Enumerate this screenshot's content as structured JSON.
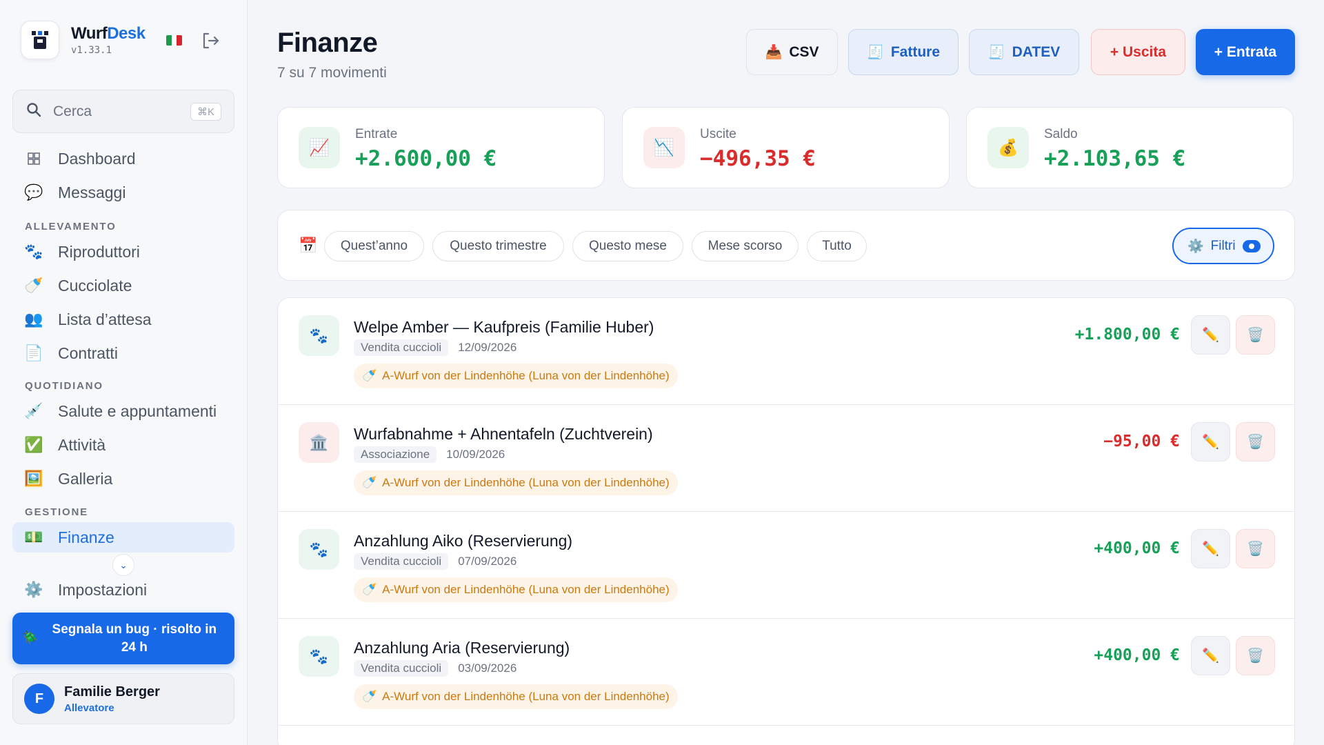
{
  "app": {
    "name_part1": "Wurf",
    "name_part2": "Desk",
    "version": "v1.33.1"
  },
  "search": {
    "label": "Cerca",
    "shortcut": "⌘K"
  },
  "nav": {
    "dashboard": "Dashboard",
    "messages": "Messaggi",
    "section_breeding": "ALLEVAMENTO",
    "breeders": "Riproduttori",
    "litters": "Cucciolate",
    "waitlist": "Lista d’attesa",
    "contracts": "Contratti",
    "section_daily": "QUOTIDIANO",
    "health": "Salute e appuntamenti",
    "tasks": "Attività",
    "gallery": "Galleria",
    "section_management": "GESTIONE",
    "finance": "Finanze",
    "settings": "Impostazioni"
  },
  "bug_button": "Segnala un bug · risolto in 24 h",
  "user": {
    "initial": "F",
    "name": "Familie Berger",
    "role": "Allevatore"
  },
  "page": {
    "title": "Finanze",
    "subtitle": "7 su 7 movimenti"
  },
  "toolbar": {
    "csv": "CSV",
    "invoices": "Fatture",
    "datev": "DATEV",
    "expense": "+ Uscita",
    "income": "+ Entrata"
  },
  "stats": {
    "income_label": "Entrate",
    "income_value": "+2.600,00 €",
    "expense_label": "Uscite",
    "expense_value": "−496,35 €",
    "balance_label": "Saldo",
    "balance_value": "+2.103,65 €"
  },
  "filters": {
    "chips": [
      "Quest’anno",
      "Questo trimestre",
      "Questo mese",
      "Mese scorso",
      "Tutto"
    ],
    "more": "Filtri"
  },
  "transactions": [
    {
      "title": "Welpe Amber — Kaufpreis (Familie Huber)",
      "category": "Vendita cuccioli",
      "date": "12/09/2026",
      "litter": "A-Wurf von der Lindenhöhe (Luna von der Lindenhöhe)",
      "amount": "+1.800,00 €",
      "type": "income",
      "icon": "paw-icon"
    },
    {
      "title": "Wurfabnahme + Ahnentafeln (Zuchtverein)",
      "category": "Associazione",
      "date": "10/09/2026",
      "litter": "A-Wurf von der Lindenhöhe (Luna von der Lindenhöhe)",
      "amount": "−95,00 €",
      "type": "expense",
      "icon": "bank-icon"
    },
    {
      "title": "Anzahlung Aiko (Reservierung)",
      "category": "Vendita cuccioli",
      "date": "07/09/2026",
      "litter": "A-Wurf von der Lindenhöhe (Luna von der Lindenhöhe)",
      "amount": "+400,00 €",
      "type": "income",
      "icon": "paw-icon"
    },
    {
      "title": "Anzahlung Aria (Reservierung)",
      "category": "Vendita cuccioli",
      "date": "03/09/2026",
      "litter": "A-Wurf von der Lindenhöhe (Luna von der Lindenhöhe)",
      "amount": "+400,00 €",
      "type": "income",
      "icon": "paw-icon"
    }
  ],
  "colors": {
    "accent": "#1769e8",
    "income": "#18a058",
    "expense": "#d92d2d",
    "litter_tag": "#c97a12"
  }
}
